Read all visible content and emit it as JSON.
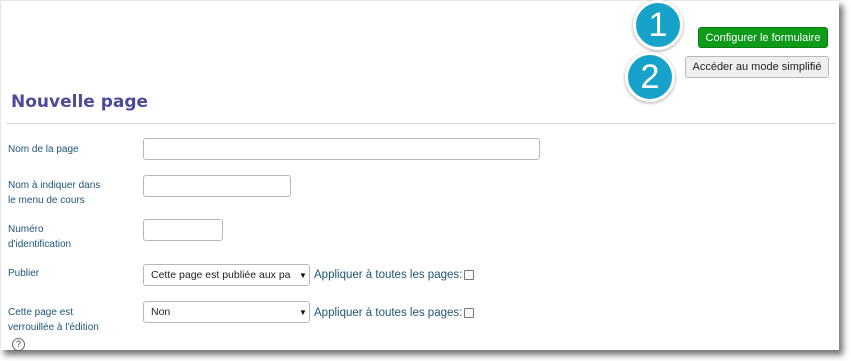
{
  "badges": [
    "1",
    "2"
  ],
  "toolbar": {
    "configure_label": "Configurer le formulaire",
    "simple_mode_label": "Accéder au mode simplifié"
  },
  "page_title": "Nouvelle page",
  "form": {
    "page_name": {
      "label": "Nom de la page",
      "value": ""
    },
    "menu_name": {
      "label_line1": "Nom à indiquer dans",
      "label_line2": "le menu de cours",
      "value": ""
    },
    "id_number": {
      "label_line1": "Numéro",
      "label_line2": "d'identification",
      "value": ""
    },
    "publish": {
      "label": "Publier",
      "selected": "Cette page est publiée aux pa",
      "apply_label": "Appliquer à toutes les pages:"
    },
    "locked": {
      "label_line1": "Cette page est",
      "label_line2": "verrouillée à l'édition",
      "selected": "Non",
      "apply_label": "Appliquer à toutes les pages:"
    }
  },
  "help_icon_glyph": "?",
  "colors": {
    "accent_green": "#0e9b1a",
    "title_purple": "#4d4a9b",
    "badge_blue": "#17a2c9",
    "label_blue": "#1f5577"
  }
}
